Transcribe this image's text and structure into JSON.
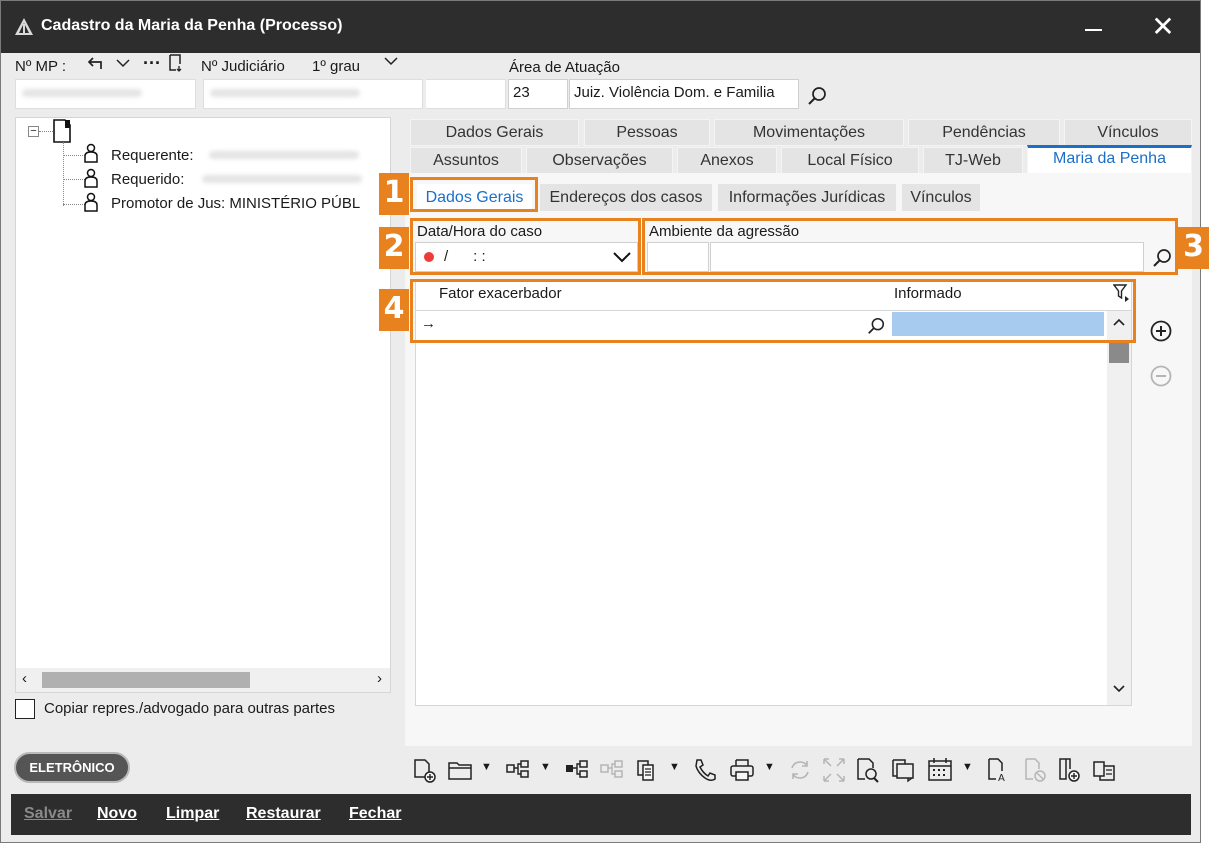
{
  "window": {
    "title": "Cadastro da Maria da Penha (Processo)"
  },
  "header": {
    "mp_label": "Nº MP :",
    "judiciario_label": "Nº Judiciário",
    "grau_label": "1º grau",
    "area_label": "Área de Atuação",
    "area_code": "23",
    "area_name": "Juiz. Violência Dom. e Familia"
  },
  "tree": {
    "items": [
      {
        "label": "Requerente:"
      },
      {
        "label": "Requerido:"
      },
      {
        "label": "Promotor de Jus: MINISTÉRIO PÚBL"
      }
    ]
  },
  "copy_checkbox": {
    "label": "Copiar repres./advogado para outras partes",
    "checked": false
  },
  "tabs_row1": [
    "Dados Gerais",
    "Pessoas",
    "Movimentações",
    "Pendências",
    "Vínculos"
  ],
  "tabs_row2": [
    "Assuntos",
    "Observações",
    "Anexos",
    "Local Físico",
    "TJ-Web",
    "Maria da Penha"
  ],
  "active_tab": "Maria da Penha",
  "subtabs": [
    "Dados Gerais",
    "Endereços dos casos",
    "Informações Jurídicas",
    "Vínculos"
  ],
  "active_subtab": "Dados Gerais",
  "form": {
    "data_hora_label": "Data/Hora do caso",
    "data_hora_value": "/      : :",
    "ambiente_label": "Ambiente da agressão",
    "ambiente_code": "",
    "ambiente_value": ""
  },
  "grid": {
    "columns": [
      "Fator exacerbador",
      "Informado"
    ],
    "new_row_marker": "→"
  },
  "annotations": [
    "1",
    "2",
    "3",
    "4"
  ],
  "badge": "ELETRÔNICO",
  "bottom_actions": [
    {
      "label": "Salvar",
      "enabled": false
    },
    {
      "label": "Novo",
      "enabled": true
    },
    {
      "label": "Limpar",
      "enabled": true
    },
    {
      "label": "Restaurar",
      "enabled": true
    },
    {
      "label": "Fechar",
      "enabled": true
    }
  ],
  "colors": {
    "accent": "#1a6fc9",
    "highlight": "#e8821e",
    "titlebar": "#2d2d2d",
    "selected_cell": "#a6cbef"
  }
}
